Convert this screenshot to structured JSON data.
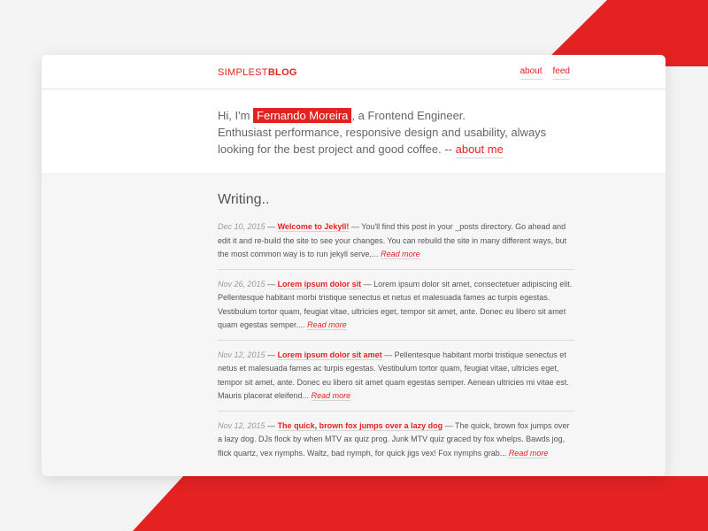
{
  "colors": {
    "accent": "#e42222",
    "background": "#f4f4f4"
  },
  "header": {
    "logo_light": "SIMPLEST",
    "logo_bold": "BLOG",
    "nav": [
      "about",
      "feed"
    ]
  },
  "intro": {
    "greeting": "Hi, I'm ",
    "name": "Fernando Moreira",
    "role": ", a Frontend Engineer.",
    "line2": "Enthusiast performance, responsive design and usability, always looking for the best project and good coffee. -- ",
    "about_link": "about me"
  },
  "writing": {
    "title": "Writing..",
    "read_more": "Read more",
    "posts": [
      {
        "date": "Dec 10, 2015",
        "title": "Welcome to Jekyll!",
        "excerpt": "You'll find this post in your _posts directory. Go ahead and edit it and re-build the site to see your changes. You can rebuild the site in many different ways, but the most common way is to run jekyll serve,..."
      },
      {
        "date": "Nov 26, 2015",
        "title": "Lorem ipsum dolor sit",
        "excerpt": "Lorem ipsum dolor sit amet, consectetuer adipiscing elit. Pellentesque habitant morbi tristique senectus et netus et malesuada fames ac turpis egestas. Vestibulum tortor quam, feugiat vitae, ultricies eget, tempor sit amet, ante. Donec eu libero sit amet quam egestas semper...."
      },
      {
        "date": "Nov 12, 2015",
        "title": "Lorem ipsum dolor sit amet",
        "excerpt": "Pellentesque habitant morbi tristique senectus et netus et malesuada fames ac turpis egestas. Vestibulum tortor quam, feugiat vitae, ultricies eget, tempor sit amet, ante. Donec eu libero sit amet quam egestas semper. Aenean ultricies mi vitae est. Mauris placerat eleifend..."
      },
      {
        "date": "Nov 12, 2015",
        "title": "The quick, brown fox jumps over a lazy dog",
        "excerpt": "The quick, brown fox jumps over a lazy dog. DJs flock by when MTV ax quiz prog. Junk MTV quiz graced by fox whelps. Bawds jog, flick quartz, vex nymphs. Waltz, bad nymph, for quick jigs vex! Fox nymphs grab..."
      }
    ]
  }
}
